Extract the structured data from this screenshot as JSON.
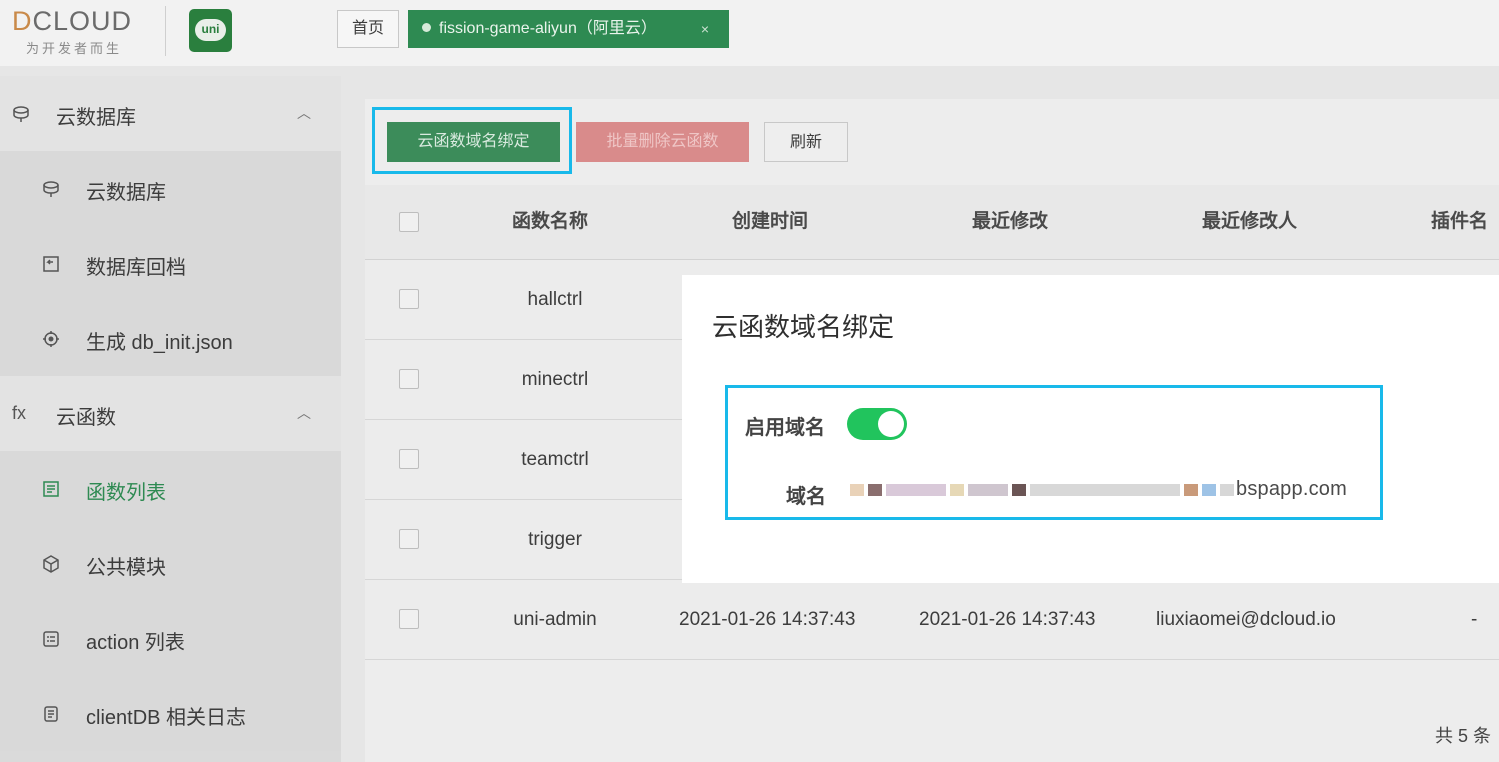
{
  "header": {
    "logo_text_d": "D",
    "logo_text_rest": "CLOUD",
    "logo_sub": "为开发者而生",
    "uni_logo_text": "uni",
    "tabs": [
      {
        "label": "首页",
        "active": false
      },
      {
        "label": "fission-game-aliyun（阿里云）",
        "active": true,
        "close": "×"
      }
    ]
  },
  "sidebar": {
    "groups": [
      {
        "label": "云数据库",
        "icon": "database-icon",
        "expanded": true,
        "items": [
          {
            "label": "云数据库",
            "icon": "database-icon"
          },
          {
            "label": "数据库回档",
            "icon": "rollback-icon"
          },
          {
            "label": "生成 db_init.json",
            "icon": "generate-icon"
          }
        ]
      },
      {
        "label": "云函数",
        "icon_text": "fx",
        "expanded": true,
        "items": [
          {
            "label": "函数列表",
            "icon": "list-icon",
            "active": true
          },
          {
            "label": "公共模块",
            "icon": "cube-icon"
          },
          {
            "label": "action 列表",
            "icon": "action-list-icon"
          },
          {
            "label": "clientDB 相关日志",
            "icon": "log-icon"
          }
        ]
      }
    ]
  },
  "toolbar": {
    "bind_label": "云函数域名绑定",
    "batch_delete_label": "批量删除云函数",
    "refresh_label": "刷新"
  },
  "table": {
    "columns": [
      "函数名称",
      "创建时间",
      "最近修改",
      "最近修改人",
      "插件名称"
    ],
    "rows": [
      {
        "name": "hallctrl",
        "created": "",
        "modified": "",
        "modifier": "",
        "plugin": ""
      },
      {
        "name": "minectrl",
        "created": "",
        "modified": "",
        "modifier": "",
        "plugin": ""
      },
      {
        "name": "teamctrl",
        "created": "",
        "modified": "",
        "modifier": "",
        "plugin": ""
      },
      {
        "name": "trigger",
        "created": "",
        "modified": "",
        "modifier": "",
        "plugin": ""
      },
      {
        "name": "uni-admin",
        "created": "2021-01-26 14:37:43",
        "modified": "2021-01-26 14:37:43",
        "modifier": "liuxiaomei@dcloud.io",
        "plugin": "-"
      }
    ],
    "total": "共 5 条"
  },
  "dialog": {
    "title": "云函数域名绑定",
    "enable_label": "启用域名",
    "enabled": true,
    "domain_label": "域名",
    "domain_value": "bspapp.com"
  },
  "colors": {
    "accent_green": "#2e8a52",
    "switch_on": "#21c45d",
    "highlight_cyan": "#18b9ea",
    "danger": "#d98b8b"
  }
}
